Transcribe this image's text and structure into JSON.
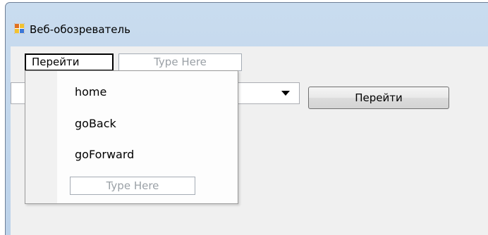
{
  "window": {
    "title": "Веб-обозреватель"
  },
  "menu": {
    "top_item_label": "Перейти",
    "top_placeholder": "Type Here",
    "items": [
      {
        "label": "home"
      },
      {
        "label": "goBack"
      },
      {
        "label": "goForward"
      }
    ],
    "dropdown_placeholder": "Type Here"
  },
  "toolbar": {
    "combo_value": "",
    "go_button_label": "Перейти"
  },
  "icons": {
    "app": "window-app-icon",
    "dropdown_arrow": "chevron-down-icon"
  },
  "colors": {
    "title_bar": "#c9dcef",
    "client_bg": "#f0f0f0",
    "placeholder_text": "#9aa0a6"
  }
}
